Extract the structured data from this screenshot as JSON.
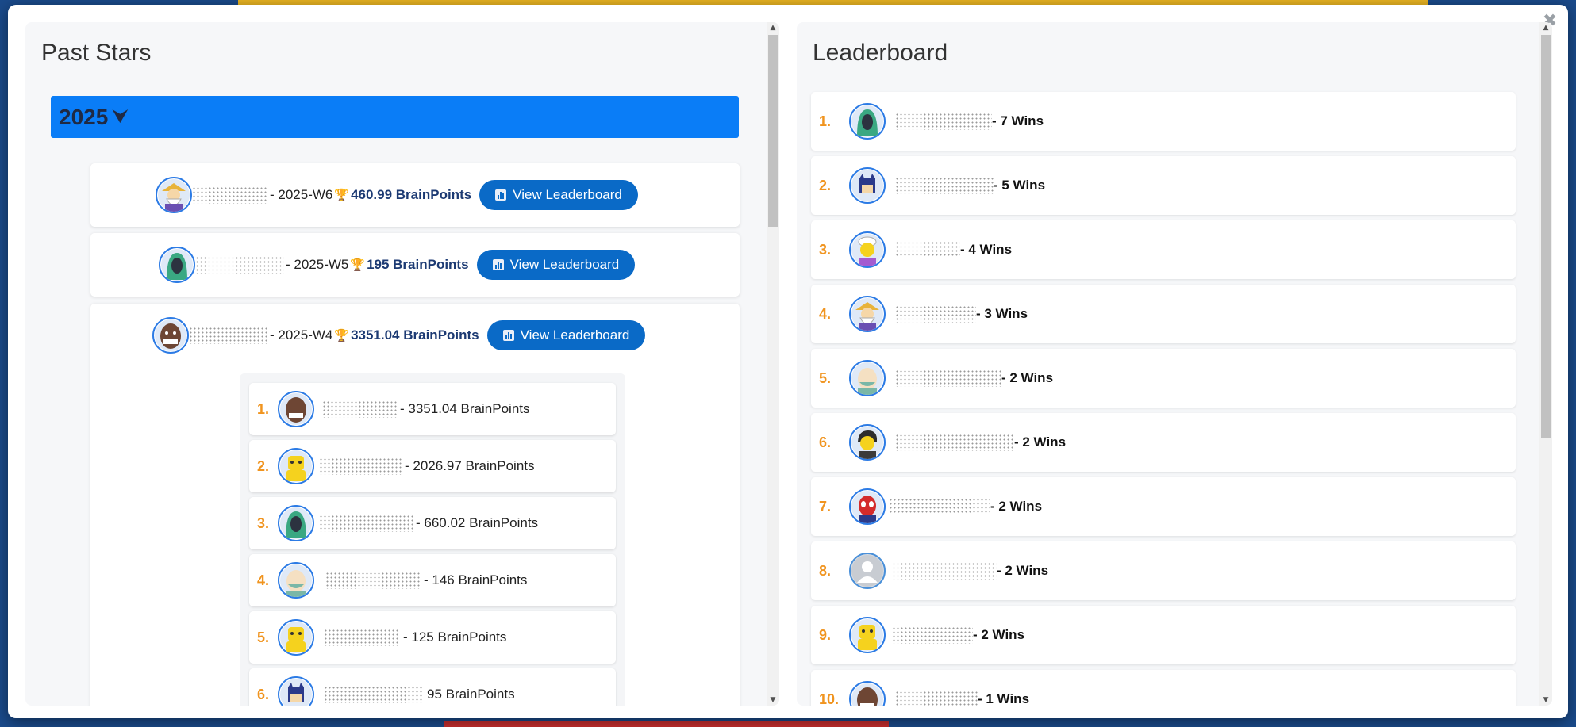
{
  "colors": {
    "accent": "#0a7df7",
    "button": "#0a6ac7",
    "rank": "#f0941f",
    "points": "#1c3a73"
  },
  "modal": {
    "close_glyph": "✖"
  },
  "past_stars": {
    "title": "Past Stars",
    "year": "2025",
    "year_chevron": "⮟",
    "weeks": [
      {
        "week": "- 2025-W6",
        "points": "460.99 BrainPoints",
        "button": "View Leaderboard",
        "avatar": "wizard-avatar"
      },
      {
        "week": "- 2025-W5",
        "points": "195 BrainPoints",
        "button": "View Leaderboard",
        "avatar": "hooded-green-avatar"
      },
      {
        "week": "- 2025-W4",
        "points": "3351.04 BrainPoints",
        "button": "View Leaderboard",
        "avatar": "brown-bald-avatar"
      }
    ],
    "week_leaderboard": [
      {
        "rank": "1.",
        "points": "- 3351.04 BrainPoints",
        "avatar": "brown-bald-avatar"
      },
      {
        "rank": "2.",
        "points": "- 2026.97 BrainPoints",
        "avatar": "yellow-robot-avatar"
      },
      {
        "rank": "3.",
        "points": "- 660.02 BrainPoints",
        "avatar": "hooded-green-avatar"
      },
      {
        "rank": "4.",
        "points": "- 146 BrainPoints",
        "avatar": "old-man-avatar"
      },
      {
        "rank": "5.",
        "points": "- 125 BrainPoints",
        "avatar": "yellow-robot-avatar"
      },
      {
        "rank": "6.",
        "points": "95 BrainPoints",
        "avatar": "bat-hero-avatar"
      }
    ]
  },
  "leaderboard": {
    "title": "Leaderboard",
    "entries": [
      {
        "rank": "1.",
        "wins": "- 7 Wins",
        "avatar": "hooded-green-avatar"
      },
      {
        "rank": "2.",
        "wins": "- 5 Wins",
        "avatar": "bat-hero-avatar"
      },
      {
        "rank": "3.",
        "wins": "- 4 Wins",
        "avatar": "turban-avatar"
      },
      {
        "rank": "4.",
        "wins": "- 3 Wins",
        "avatar": "wizard-avatar"
      },
      {
        "rank": "5.",
        "wins": "- 2 Wins",
        "avatar": "old-man-avatar"
      },
      {
        "rank": "6.",
        "wins": "- 2 Wins",
        "avatar": "dark-hair-avatar"
      },
      {
        "rank": "7.",
        "wins": "- 2 Wins",
        "avatar": "spider-hero-avatar"
      },
      {
        "rank": "8.",
        "wins": "- 2 Wins",
        "avatar": "default-user-avatar"
      },
      {
        "rank": "9.",
        "wins": "- 2 Wins",
        "avatar": "yellow-robot-avatar"
      },
      {
        "rank": "10.",
        "wins": "- 1 Wins",
        "avatar": "brown-bald-avatar"
      }
    ]
  }
}
